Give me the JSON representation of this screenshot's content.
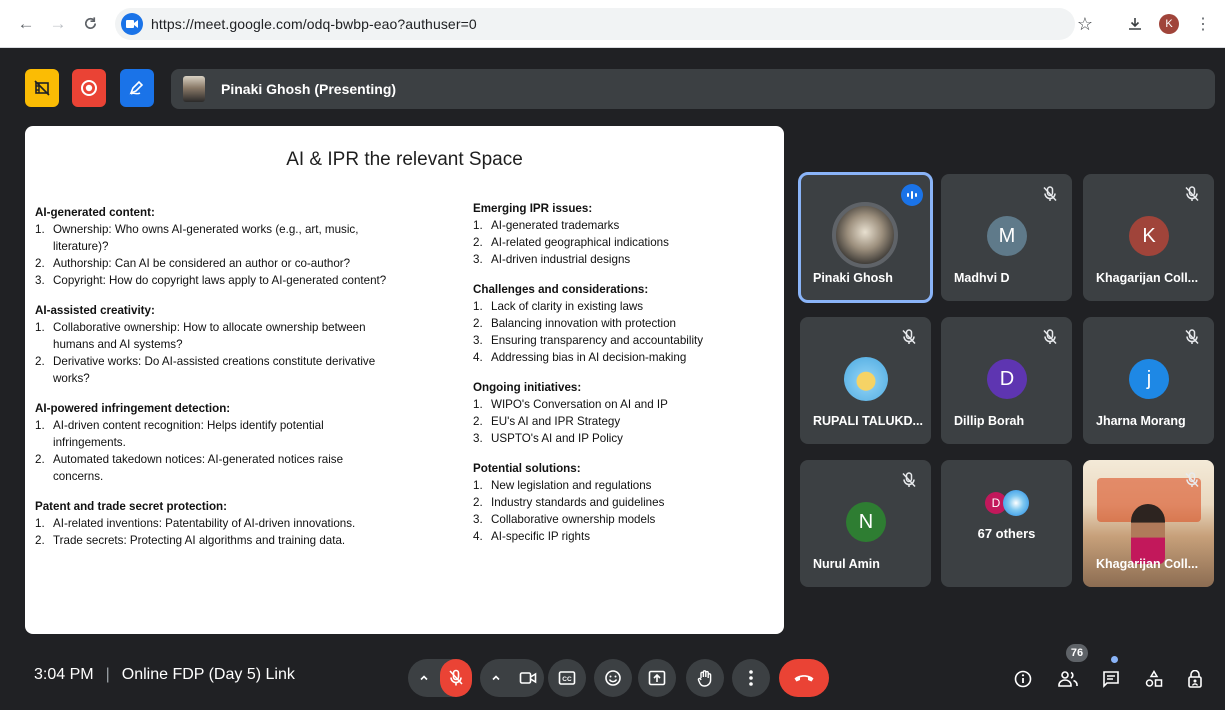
{
  "browser": {
    "url": "https://meet.google.com/odq-bwbp-eao?authuser=0",
    "profile_initial": "K"
  },
  "presenter": {
    "label": "Pinaki Ghosh (Presenting)"
  },
  "slide": {
    "title": "AI & IPR the relevant Space",
    "left_sections": [
      {
        "heading": "AI-generated content:",
        "items": [
          {
            "num": "1.",
            "lines": [
              "Ownership: Who owns AI-generated works (e.g., art, music,",
              "literature)?"
            ]
          },
          {
            "num": "2.",
            "lines": [
              "Authorship: Can AI be considered an author or co-author?"
            ]
          },
          {
            "num": "3.",
            "lines": [
              "Copyright: How do copyright laws apply to AI-generated content?"
            ]
          }
        ]
      },
      {
        "heading": "AI-assisted creativity:",
        "items": [
          {
            "num": "1.",
            "lines": [
              "Collaborative ownership: How to allocate ownership between",
              "humans and AI systems?"
            ]
          },
          {
            "num": "2.",
            "lines": [
              "Derivative works: Do AI-assisted creations constitute derivative",
              "works?"
            ]
          }
        ]
      },
      {
        "heading": "AI-powered infringement detection:",
        "items": [
          {
            "num": "1.",
            "lines": [
              "AI-driven content recognition: Helps identify potential",
              "infringements."
            ]
          },
          {
            "num": "2.",
            "lines": [
              "Automated takedown notices: AI-generated notices raise",
              "concerns."
            ]
          }
        ]
      },
      {
        "heading": "Patent and trade secret protection:",
        "items": [
          {
            "num": "1.",
            "lines": [
              "AI-related inventions: Patentability of AI-driven innovations."
            ]
          },
          {
            "num": "2.",
            "lines": [
              "Trade secrets: Protecting AI algorithms and training data."
            ]
          }
        ]
      }
    ],
    "right_sections": [
      {
        "heading": "Emerging IPR issues:",
        "items": [
          {
            "num": "1.",
            "lines": [
              "AI-generated trademarks"
            ]
          },
          {
            "num": "2.",
            "lines": [
              "AI-related geographical indications"
            ]
          },
          {
            "num": "3.",
            "lines": [
              "AI-driven industrial designs"
            ]
          }
        ]
      },
      {
        "heading": "Challenges and considerations:",
        "items": [
          {
            "num": "1.",
            "lines": [
              "Lack of clarity in existing laws"
            ]
          },
          {
            "num": "2.",
            "lines": [
              "Balancing innovation with protection"
            ]
          },
          {
            "num": "3.",
            "lines": [
              "Ensuring transparency and accountability"
            ]
          },
          {
            "num": "4.",
            "lines": [
              "Addressing bias in AI decision-making"
            ]
          }
        ]
      },
      {
        "heading": "Ongoing initiatives:",
        "items": [
          {
            "num": "1.",
            "lines": [
              "WIPO's Conversation on AI and IP"
            ]
          },
          {
            "num": "2.",
            "lines": [
              "EU's AI and IPR Strategy"
            ]
          },
          {
            "num": "3.",
            "lines": [
              "USPTO's AI and IP Policy"
            ]
          }
        ]
      },
      {
        "heading": "Potential solutions:",
        "items": [
          {
            "num": "1.",
            "lines": [
              "New legislation and regulations"
            ]
          },
          {
            "num": "2.",
            "lines": [
              "Industry standards and guidelines"
            ]
          },
          {
            "num": "3.",
            "lines": [
              "Collaborative ownership models"
            ]
          },
          {
            "num": "4.",
            "lines": [
              "AI-specific IP rights"
            ]
          }
        ]
      }
    ]
  },
  "participants": [
    {
      "name": "Pinaki Ghosh",
      "initial": "",
      "avatar_type": "photo",
      "color": "",
      "muted": false,
      "speaking": true
    },
    {
      "name": "Madhvi D",
      "initial": "M",
      "avatar_type": "letter",
      "color": "#5f7a8a",
      "muted": true,
      "speaking": false
    },
    {
      "name": "Khagarijan Coll...",
      "initial": "K",
      "avatar_type": "letter",
      "color": "#a0443a",
      "muted": true,
      "speaking": false
    },
    {
      "name": "RUPALI TALUKD...",
      "initial": "",
      "avatar_type": "image",
      "color": "#7fc8f0",
      "muted": true,
      "speaking": false
    },
    {
      "name": "Dillip Borah",
      "initial": "D",
      "avatar_type": "letter",
      "color": "#5e35b1",
      "muted": true,
      "speaking": false
    },
    {
      "name": "Jharna Morang",
      "initial": "j",
      "avatar_type": "letter",
      "color": "#1e88e5",
      "muted": true,
      "speaking": false
    },
    {
      "name": "Nurul Amin",
      "initial": "N",
      "avatar_type": "letter",
      "color": "#2e7d32",
      "muted": true,
      "speaking": false
    },
    {
      "name": "67 others",
      "initial": "D",
      "avatar_type": "group",
      "color": "#c2185b",
      "muted": false,
      "speaking": false
    },
    {
      "name": "Khagarijan Coll...",
      "initial": "",
      "avatar_type": "video",
      "color": "",
      "muted": true,
      "speaking": false
    }
  ],
  "meeting": {
    "time": "3:04 PM",
    "separator": "|",
    "title": "Online FDP (Day 5) Link",
    "participant_count": "76"
  },
  "colors": {
    "accent_blue": "#1a73e8",
    "end_call_red": "#ea4335",
    "tile_bg": "#3c4043"
  }
}
